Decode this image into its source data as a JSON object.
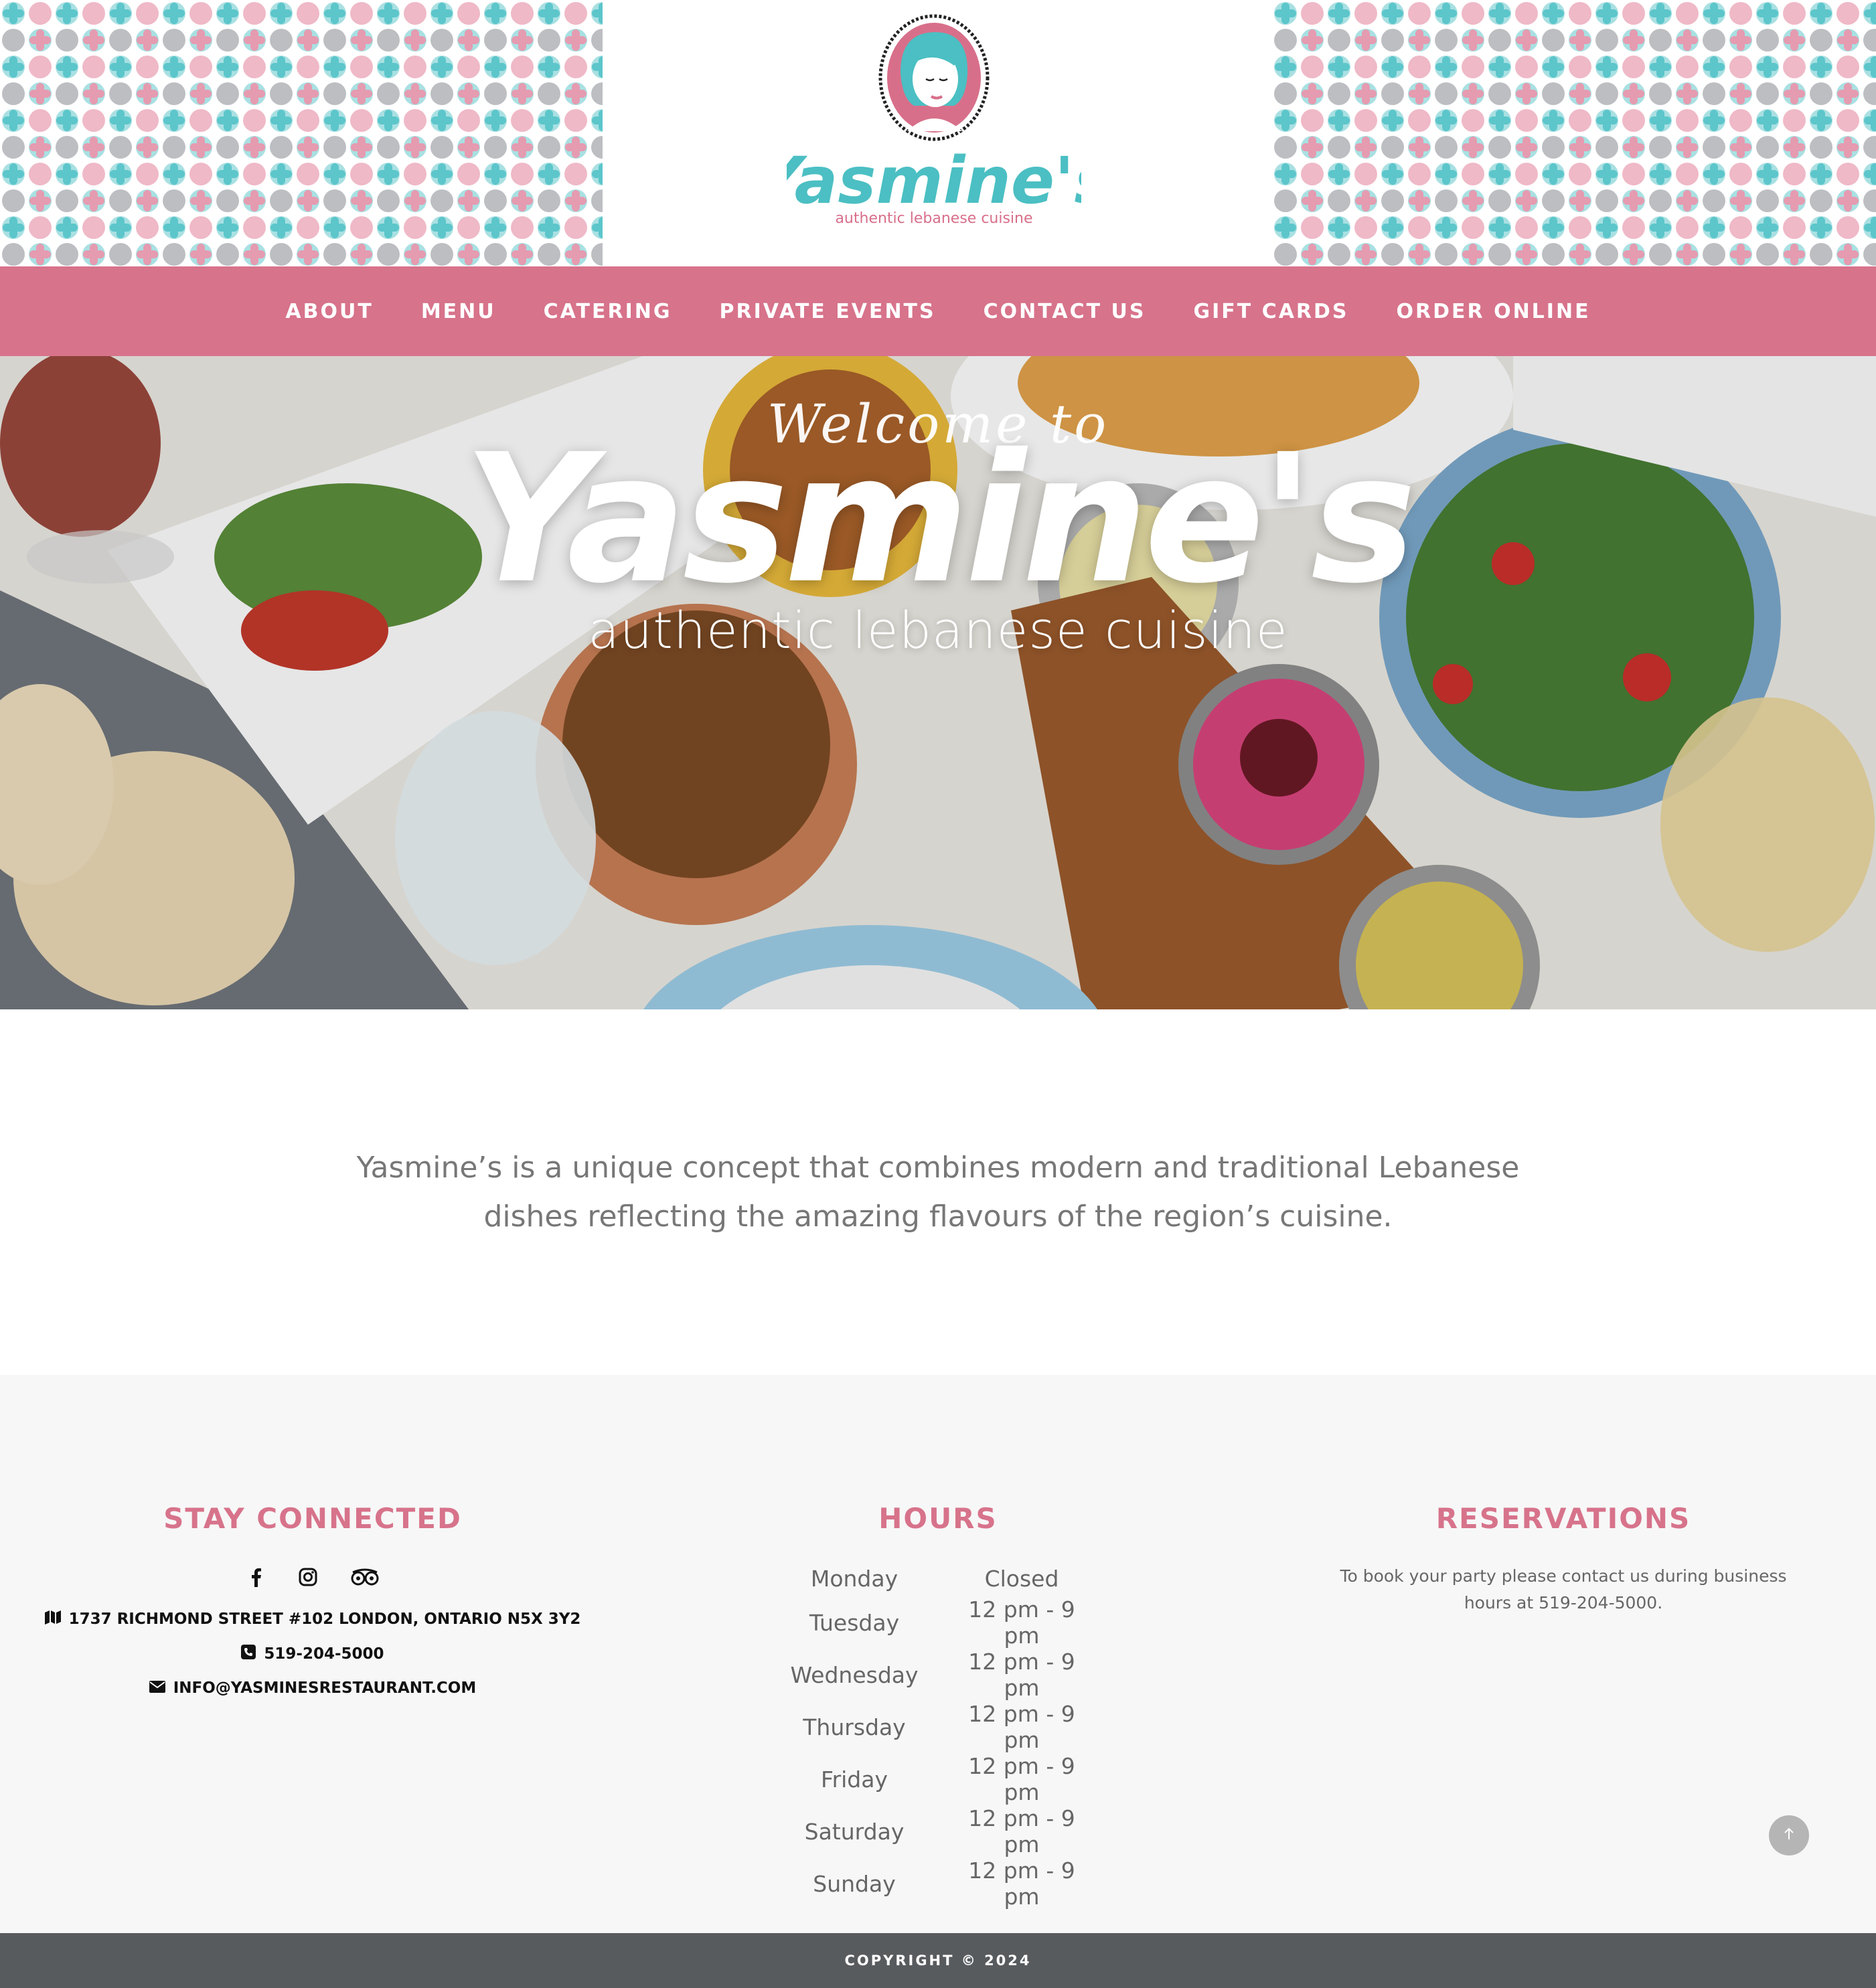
{
  "brand": {
    "name": "Yasmine's",
    "tagline": "authentic lebanese cuisine",
    "colors": {
      "pink": "#d7738b",
      "teal": "#4bbfc3",
      "footer": "#585b5e",
      "section_bg": "#f7f7f7"
    }
  },
  "nav": {
    "items": [
      {
        "label": "ABOUT"
      },
      {
        "label": "MENU"
      },
      {
        "label": "CATERING"
      },
      {
        "label": "PRIVATE EVENTS"
      },
      {
        "label": "CONTACT US"
      },
      {
        "label": "GIFT CARDS"
      },
      {
        "label": "ORDER ONLINE"
      }
    ]
  },
  "hero": {
    "welcome": "Welcome to",
    "title": "Yasmine's",
    "subtitle": "authentic lebanese cuisine"
  },
  "intro": {
    "text": "Yasmine’s is a unique concept that combines modern and traditional Lebanese dishes reflecting the amazing flavours of the region’s cuisine."
  },
  "stay_connected": {
    "heading": "STAY CONNECTED",
    "social_icons": [
      "facebook-icon",
      "instagram-icon",
      "tripadvisor-icon"
    ],
    "address": "1737 RICHMOND STREET #102 LONDON, ONTARIO N5X 3Y2",
    "phone": "519-204-5000",
    "email": "INFO@YASMINESRESTAURANT.COM"
  },
  "hours": {
    "heading": "HOURS",
    "rows": [
      {
        "day": "Monday",
        "time": "Closed"
      },
      {
        "day": "Tuesday",
        "time": "12 pm - 9 pm"
      },
      {
        "day": "Wednesday",
        "time": "12 pm - 9 pm"
      },
      {
        "day": "Thursday",
        "time": "12 pm - 9 pm"
      },
      {
        "day": "Friday",
        "time": "12 pm - 9 pm"
      },
      {
        "day": "Saturday",
        "time": "12 pm - 9 pm"
      },
      {
        "day": "Sunday",
        "time": "12 pm - 9 pm"
      }
    ]
  },
  "reservations": {
    "heading": "RESERVATIONS",
    "text": "To book your party please contact us during business hours at 519-204-5000."
  },
  "footer": {
    "copyright": "COPYRIGHT © 2024"
  }
}
